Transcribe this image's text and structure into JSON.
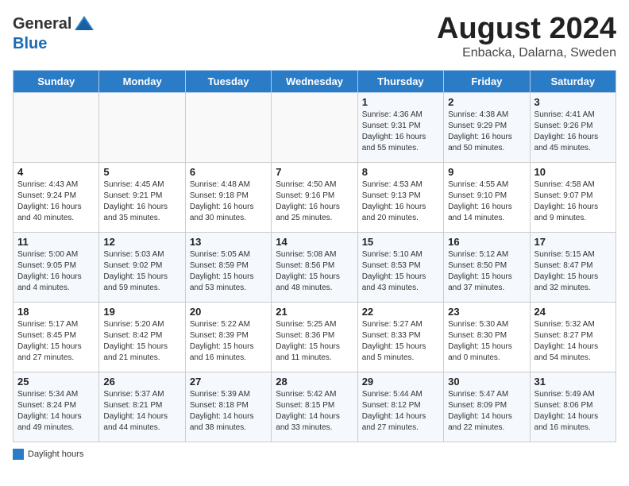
{
  "header": {
    "logo_general": "General",
    "logo_blue": "Blue",
    "title": "August 2024",
    "subtitle": "Enbacka, Dalarna, Sweden"
  },
  "days_of_week": [
    "Sunday",
    "Monday",
    "Tuesday",
    "Wednesday",
    "Thursday",
    "Friday",
    "Saturday"
  ],
  "weeks": [
    [
      {
        "day": "",
        "info": ""
      },
      {
        "day": "",
        "info": ""
      },
      {
        "day": "",
        "info": ""
      },
      {
        "day": "",
        "info": ""
      },
      {
        "day": "1",
        "info": "Sunrise: 4:36 AM\nSunset: 9:31 PM\nDaylight: 16 hours\nand 55 minutes."
      },
      {
        "day": "2",
        "info": "Sunrise: 4:38 AM\nSunset: 9:29 PM\nDaylight: 16 hours\nand 50 minutes."
      },
      {
        "day": "3",
        "info": "Sunrise: 4:41 AM\nSunset: 9:26 PM\nDaylight: 16 hours\nand 45 minutes."
      }
    ],
    [
      {
        "day": "4",
        "info": "Sunrise: 4:43 AM\nSunset: 9:24 PM\nDaylight: 16 hours\nand 40 minutes."
      },
      {
        "day": "5",
        "info": "Sunrise: 4:45 AM\nSunset: 9:21 PM\nDaylight: 16 hours\nand 35 minutes."
      },
      {
        "day": "6",
        "info": "Sunrise: 4:48 AM\nSunset: 9:18 PM\nDaylight: 16 hours\nand 30 minutes."
      },
      {
        "day": "7",
        "info": "Sunrise: 4:50 AM\nSunset: 9:16 PM\nDaylight: 16 hours\nand 25 minutes."
      },
      {
        "day": "8",
        "info": "Sunrise: 4:53 AM\nSunset: 9:13 PM\nDaylight: 16 hours\nand 20 minutes."
      },
      {
        "day": "9",
        "info": "Sunrise: 4:55 AM\nSunset: 9:10 PM\nDaylight: 16 hours\nand 14 minutes."
      },
      {
        "day": "10",
        "info": "Sunrise: 4:58 AM\nSunset: 9:07 PM\nDaylight: 16 hours\nand 9 minutes."
      }
    ],
    [
      {
        "day": "11",
        "info": "Sunrise: 5:00 AM\nSunset: 9:05 PM\nDaylight: 16 hours\nand 4 minutes."
      },
      {
        "day": "12",
        "info": "Sunrise: 5:03 AM\nSunset: 9:02 PM\nDaylight: 15 hours\nand 59 minutes."
      },
      {
        "day": "13",
        "info": "Sunrise: 5:05 AM\nSunset: 8:59 PM\nDaylight: 15 hours\nand 53 minutes."
      },
      {
        "day": "14",
        "info": "Sunrise: 5:08 AM\nSunset: 8:56 PM\nDaylight: 15 hours\nand 48 minutes."
      },
      {
        "day": "15",
        "info": "Sunrise: 5:10 AM\nSunset: 8:53 PM\nDaylight: 15 hours\nand 43 minutes."
      },
      {
        "day": "16",
        "info": "Sunrise: 5:12 AM\nSunset: 8:50 PM\nDaylight: 15 hours\nand 37 minutes."
      },
      {
        "day": "17",
        "info": "Sunrise: 5:15 AM\nSunset: 8:47 PM\nDaylight: 15 hours\nand 32 minutes."
      }
    ],
    [
      {
        "day": "18",
        "info": "Sunrise: 5:17 AM\nSunset: 8:45 PM\nDaylight: 15 hours\nand 27 minutes."
      },
      {
        "day": "19",
        "info": "Sunrise: 5:20 AM\nSunset: 8:42 PM\nDaylight: 15 hours\nand 21 minutes."
      },
      {
        "day": "20",
        "info": "Sunrise: 5:22 AM\nSunset: 8:39 PM\nDaylight: 15 hours\nand 16 minutes."
      },
      {
        "day": "21",
        "info": "Sunrise: 5:25 AM\nSunset: 8:36 PM\nDaylight: 15 hours\nand 11 minutes."
      },
      {
        "day": "22",
        "info": "Sunrise: 5:27 AM\nSunset: 8:33 PM\nDaylight: 15 hours\nand 5 minutes."
      },
      {
        "day": "23",
        "info": "Sunrise: 5:30 AM\nSunset: 8:30 PM\nDaylight: 15 hours\nand 0 minutes."
      },
      {
        "day": "24",
        "info": "Sunrise: 5:32 AM\nSunset: 8:27 PM\nDaylight: 14 hours\nand 54 minutes."
      }
    ],
    [
      {
        "day": "25",
        "info": "Sunrise: 5:34 AM\nSunset: 8:24 PM\nDaylight: 14 hours\nand 49 minutes."
      },
      {
        "day": "26",
        "info": "Sunrise: 5:37 AM\nSunset: 8:21 PM\nDaylight: 14 hours\nand 44 minutes."
      },
      {
        "day": "27",
        "info": "Sunrise: 5:39 AM\nSunset: 8:18 PM\nDaylight: 14 hours\nand 38 minutes."
      },
      {
        "day": "28",
        "info": "Sunrise: 5:42 AM\nSunset: 8:15 PM\nDaylight: 14 hours\nand 33 minutes."
      },
      {
        "day": "29",
        "info": "Sunrise: 5:44 AM\nSunset: 8:12 PM\nDaylight: 14 hours\nand 27 minutes."
      },
      {
        "day": "30",
        "info": "Sunrise: 5:47 AM\nSunset: 8:09 PM\nDaylight: 14 hours\nand 22 minutes."
      },
      {
        "day": "31",
        "info": "Sunrise: 5:49 AM\nSunset: 8:06 PM\nDaylight: 14 hours\nand 16 minutes."
      }
    ]
  ],
  "footer": {
    "legend_label": "Daylight hours"
  }
}
